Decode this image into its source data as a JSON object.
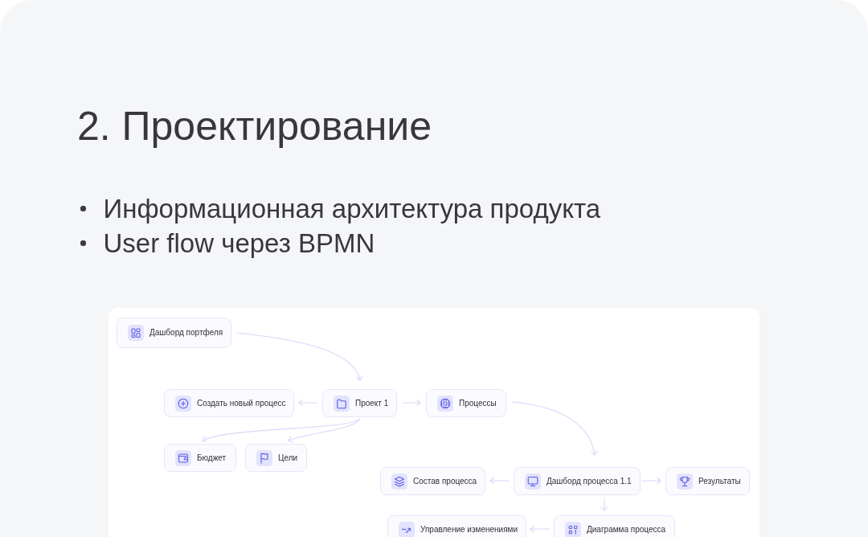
{
  "title": "2. Проектирование",
  "bullets": [
    "Информационная архитектура продукта",
    "User flow через BPMN"
  ],
  "diagram": {
    "nodes": [
      {
        "label": "Дашборд портфеля"
      },
      {
        "label": "Создать новый процесс"
      },
      {
        "label": "Проект 1"
      },
      {
        "label": "Процессы"
      },
      {
        "label": "Бюджет"
      },
      {
        "label": "Цели"
      },
      {
        "label": "Состав процесса"
      },
      {
        "label": "Дашборд процесса 1.1"
      },
      {
        "label": "Результаты"
      },
      {
        "label": "Управление изменениями"
      },
      {
        "label": "Диаграмма процесса"
      }
    ]
  }
}
